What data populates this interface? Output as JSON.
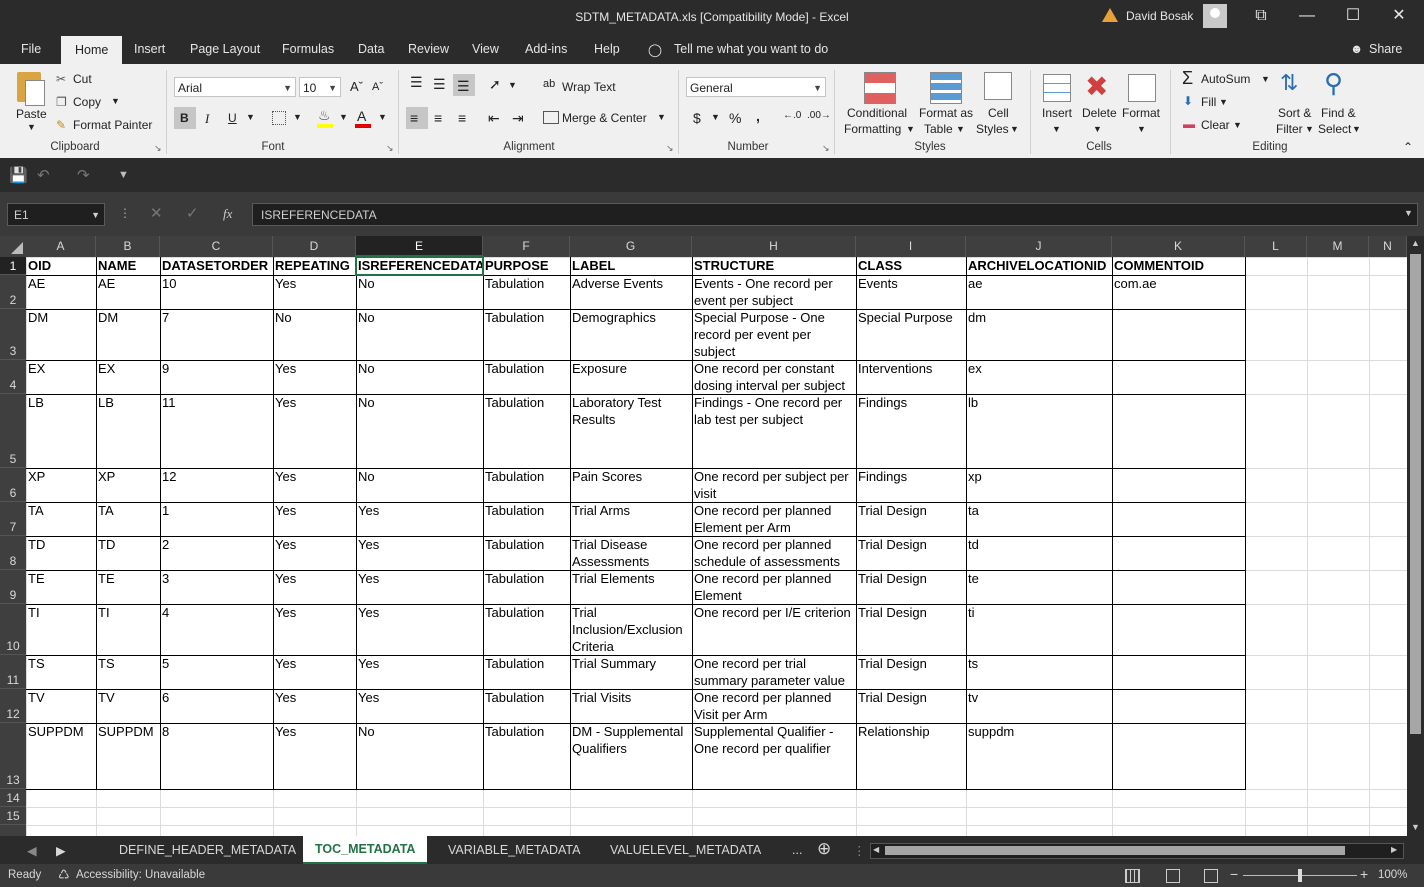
{
  "window": {
    "title": "SDTM_METADATA.xls  [Compatibility Mode]  -  Excel",
    "user": "David Bosak",
    "controls": {
      "minimize": "—",
      "maximize": "☐",
      "close": "✕",
      "restore": "⧉"
    }
  },
  "ribbon_tabs": [
    "File",
    "Home",
    "Insert",
    "Page Layout",
    "Formulas",
    "Data",
    "Review",
    "View",
    "Add-ins",
    "Help"
  ],
  "tell_me": "Tell me what you want to do",
  "share": "Share",
  "clipboard": {
    "paste": "Paste",
    "cut": "Cut",
    "copy": "Copy",
    "format_painter": "Format Painter",
    "group": "Clipboard"
  },
  "font": {
    "name": "Arial",
    "size": "10",
    "bold": "B",
    "italic": "I",
    "underline": "U",
    "group": "Font"
  },
  "alignment": {
    "wrap": "Wrap Text",
    "merge": "Merge & Center",
    "group": "Alignment"
  },
  "number": {
    "format": "General",
    "currency": "$",
    "percent": "%",
    "comma": ",",
    "group": "Number"
  },
  "styles": {
    "conditional": "Conditional",
    "conditional2": "Formatting",
    "format_table": "Format as",
    "format_table2": "Table",
    "cell_styles": "Cell",
    "cell_styles2": "Styles",
    "group": "Styles"
  },
  "cells": {
    "insert": "Insert",
    "delete": "Delete",
    "format": "Format",
    "group": "Cells"
  },
  "editing": {
    "autosum": "AutoSum",
    "fill": "Fill",
    "clear": "Clear",
    "sort": "Sort &",
    "sort2": "Filter",
    "find": "Find &",
    "find2": "Select",
    "group": "Editing"
  },
  "formula_bar": {
    "name_box": "E1",
    "fx": "fx",
    "value": "ISREFERENCEDATA"
  },
  "columns": [
    "A",
    "B",
    "C",
    "D",
    "E",
    "F",
    "G",
    "H",
    "I",
    "J",
    "K",
    "L",
    "M",
    "N"
  ],
  "sheet": {
    "headers": [
      "OID",
      "NAME",
      "DATASETORDER",
      "REPEATING",
      "ISREFERENCEDATA",
      "PURPOSE",
      "LABEL",
      "STRUCTURE",
      "CLASS",
      "ARCHIVELOCATIONID",
      "COMMENTOID"
    ],
    "rows": [
      [
        "AE",
        "AE",
        "10",
        "Yes",
        "No",
        "Tabulation",
        "Adverse Events",
        "Events - One record per event per subject",
        "Events",
        "ae",
        "com.ae"
      ],
      [
        "DM",
        "DM",
        "7",
        "No",
        "No",
        "Tabulation",
        "Demographics",
        "Special Purpose - One record per event per subject",
        "Special Purpose",
        "dm",
        ""
      ],
      [
        "EX",
        "EX",
        "9",
        "Yes",
        "No",
        "Tabulation",
        "Exposure",
        "One record per constant dosing interval per subject",
        "Interventions",
        "ex",
        ""
      ],
      [
        "LB",
        "LB",
        "11",
        "Yes",
        "No",
        "Tabulation",
        "Laboratory Test Results",
        "Findings - One record per lab test per subject",
        "Findings",
        "lb",
        ""
      ],
      [
        "XP",
        "XP",
        "12",
        "Yes",
        "No",
        "Tabulation",
        "Pain Scores",
        "One record per subject per visit",
        "Findings",
        "xp",
        ""
      ],
      [
        "TA",
        "TA",
        "1",
        "Yes",
        "Yes",
        "Tabulation",
        "Trial Arms",
        "One record per planned Element per Arm",
        "Trial Design",
        "ta",
        ""
      ],
      [
        "TD",
        "TD",
        "2",
        "Yes",
        "Yes",
        "Tabulation",
        "Trial Disease Assessments",
        "One record per planned schedule of assessments",
        "Trial Design",
        "td",
        ""
      ],
      [
        "TE",
        "TE",
        "3",
        "Yes",
        "Yes",
        "Tabulation",
        "Trial Elements",
        "One record per planned Element",
        "Trial Design",
        "te",
        ""
      ],
      [
        "TI",
        "TI",
        "4",
        "Yes",
        "Yes",
        "Tabulation",
        "Trial Inclusion/Exclusion Criteria",
        "One record per I/E criterion",
        "Trial Design",
        "ti",
        ""
      ],
      [
        "TS",
        "TS",
        "5",
        "Yes",
        "Yes",
        "Tabulation",
        "Trial Summary",
        "One record per trial summary parameter value",
        "Trial Design",
        "ts",
        ""
      ],
      [
        "TV",
        "TV",
        "6",
        "Yes",
        "Yes",
        "Tabulation",
        "Trial Visits",
        "One record per planned Visit per Arm",
        "Trial Design",
        "tv",
        ""
      ],
      [
        "SUPPDM",
        "SUPPDM",
        "8",
        "Yes",
        "No",
        "Tabulation",
        "DM - Supplemental Qualifiers",
        "Supplemental Qualifier - One record per qualifier",
        "Relationship",
        "suppdm",
        ""
      ]
    ],
    "row_numbers": [
      "1",
      "2",
      "3",
      "4",
      "5",
      "6",
      "7",
      "8",
      "9",
      "10",
      "11",
      "12",
      "13",
      "14",
      "15"
    ]
  },
  "sheet_tabs": [
    "DEFINE_HEADER_METADATA",
    "TOC_METADATA",
    "VARIABLE_METADATA",
    "VALUELEVEL_METADATA"
  ],
  "sheet_tabs_more": "...",
  "status": {
    "ready": "Ready",
    "accessibility": "Accessibility: Unavailable",
    "zoom": "100%"
  },
  "colors": {
    "excel_green": "#217346",
    "dark": "#2b2b2b"
  }
}
